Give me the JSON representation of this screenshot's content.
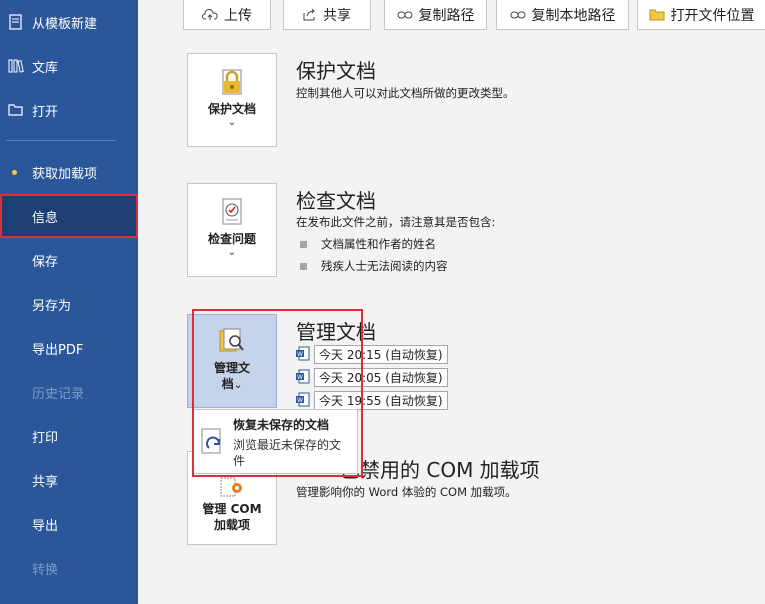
{
  "sidebar": {
    "items": [
      {
        "label": "从模板新建",
        "icon": "new-from-template-icon"
      },
      {
        "label": "文库",
        "icon": "library-icon"
      },
      {
        "label": "打开",
        "icon": "folder-open-icon"
      },
      {
        "label": "获取加载项",
        "icon": "dot-icon"
      },
      {
        "label": "信息"
      },
      {
        "label": "保存"
      },
      {
        "label": "另存为"
      },
      {
        "label": "导出PDF"
      },
      {
        "label": "历史记录"
      },
      {
        "label": "打印"
      },
      {
        "label": "共享"
      },
      {
        "label": "导出"
      },
      {
        "label": "转换"
      }
    ]
  },
  "toolbar": {
    "upload": "上传",
    "share": "共享",
    "copy_path": "复制路径",
    "copy_local_path": "复制本地路径",
    "open_location": "打开文件位置"
  },
  "protect": {
    "tile_label": "保护文档",
    "title": "保护文档",
    "desc": "控制其他人可以对此文档所做的更改类型。"
  },
  "inspect": {
    "tile_label": "检查问题",
    "title": "检查文档",
    "desc": "在发布此文件之前，请注意其是否包含:",
    "bullets": [
      "文档属性和作者的姓名",
      "残疾人士无法阅读的内容"
    ]
  },
  "manage": {
    "tile_label_1": "管理文",
    "tile_label_2": "档",
    "title": "管理文档",
    "versions": [
      "今天 20:15 (自动恢复)",
      "今天 20:05 (自动恢复)",
      "今天 19:55 (自动恢复)"
    ]
  },
  "dropdown": {
    "title": "恢复未保存的文档",
    "desc": "浏览最近未保存的文件"
  },
  "com": {
    "tile_label": "管理 COM 加载项",
    "title": "已禁用的 COM 加载项",
    "desc": "管理影响你的 Word 体验的 COM 加载项。"
  },
  "colors": {
    "sidebar": "#2b579a",
    "highlight": "#d9303a",
    "accent": "#f2c744"
  }
}
